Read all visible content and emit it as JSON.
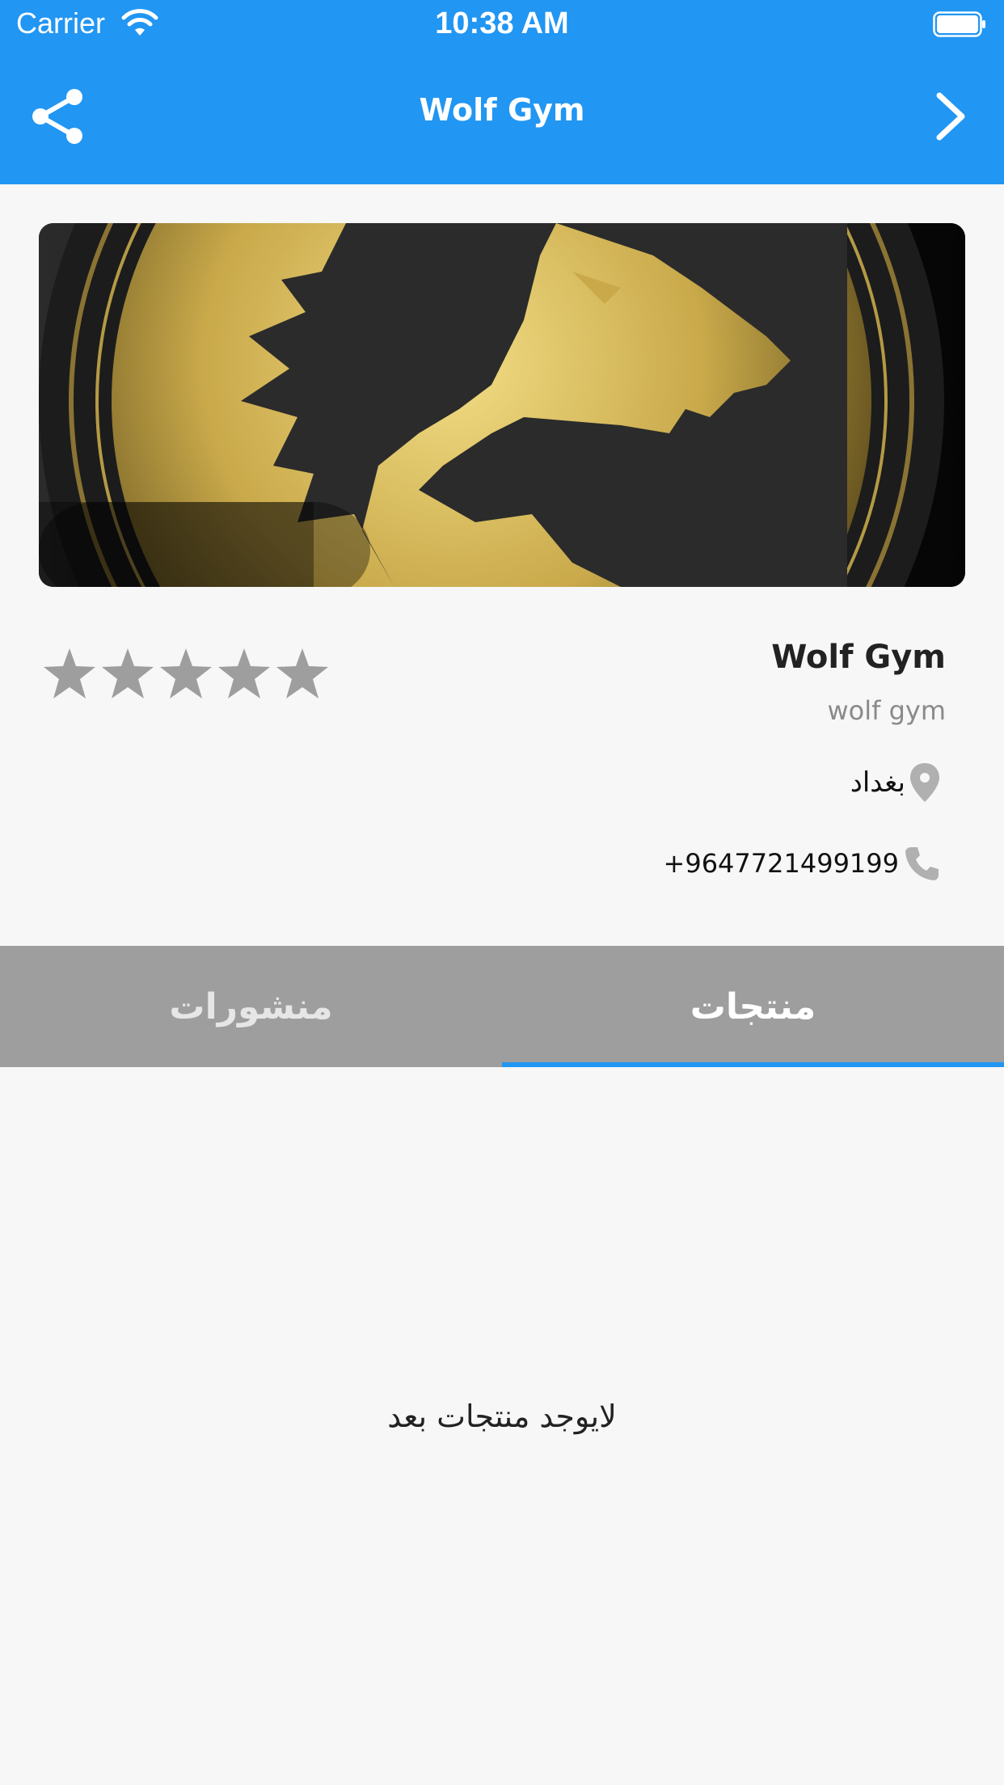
{
  "status_bar": {
    "carrier": "Carrier",
    "time": "10:38 AM"
  },
  "app_bar": {
    "title": "Wolf Gym",
    "color": "#2196f3"
  },
  "profile": {
    "name": "Wolf Gym",
    "subtitle": "wolf gym",
    "location": "بغداد",
    "phone": "+9647721499199",
    "rating": {
      "value": 0,
      "max": 5
    }
  },
  "tabs": [
    {
      "label": "منشورات",
      "selected": false
    },
    {
      "label": "منتجات",
      "selected": true
    }
  ],
  "content": {
    "empty_message": "لايوجد منتجات بعد"
  },
  "icons": {
    "share": "share-icon",
    "forward": "chevron-right-icon",
    "location": "location-pin-icon",
    "phone": "phone-icon",
    "star": "star-icon"
  },
  "colors": {
    "accent": "#2196f3",
    "tab_bar": "#9e9e9e",
    "star_empty": "#9e9e9e",
    "icon_gray": "#b0b0b0"
  }
}
